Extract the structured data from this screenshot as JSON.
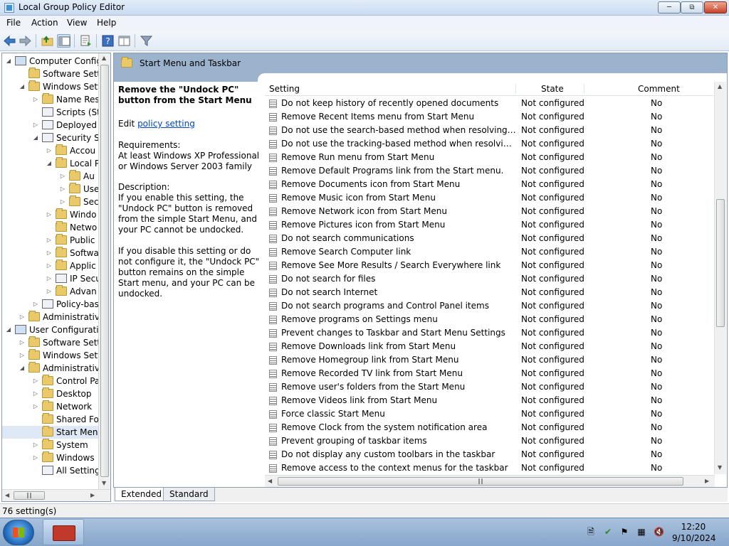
{
  "window": {
    "title": "Local Group Policy Editor",
    "minimize_icon": "minimize-icon",
    "maximize_icon": "maximize-icon",
    "close_icon": "close-icon"
  },
  "menu": [
    "File",
    "Action",
    "View",
    "Help"
  ],
  "toolbar": {
    "icons": [
      "back-arrow-icon",
      "forward-arrow-icon",
      "up-folder-icon",
      "show-hide-tree-icon",
      "export-list-icon",
      "help-icon",
      "properties-icon",
      "filter-icon"
    ]
  },
  "tree": {
    "items": [
      {
        "label": "Computer Config",
        "level": 0,
        "expanded": true,
        "icon": "computer-icon"
      },
      {
        "label": "Software Setti",
        "level": 1,
        "expanded": null,
        "icon": "folder-icon"
      },
      {
        "label": "Windows Sett",
        "level": 1,
        "expanded": true,
        "icon": "folder-icon"
      },
      {
        "label": "Name Res",
        "level": 2,
        "expanded": false,
        "icon": "folder-icon"
      },
      {
        "label": "Scripts (St",
        "level": 2,
        "expanded": null,
        "icon": "scripts-icon"
      },
      {
        "label": "Deployed",
        "level": 2,
        "expanded": false,
        "icon": "printer-icon"
      },
      {
        "label": "Security Se",
        "level": 2,
        "expanded": true,
        "icon": "security-icon"
      },
      {
        "label": "Accou",
        "level": 3,
        "expanded": false,
        "icon": "folder-icon"
      },
      {
        "label": "Local P",
        "level": 3,
        "expanded": true,
        "icon": "folder-icon"
      },
      {
        "label": "Au",
        "level": 4,
        "expanded": false,
        "icon": "folder-icon"
      },
      {
        "label": "Use",
        "level": 4,
        "expanded": false,
        "icon": "folder-icon"
      },
      {
        "label": "Sec",
        "level": 4,
        "expanded": false,
        "icon": "folder-icon"
      },
      {
        "label": "Windo",
        "level": 3,
        "expanded": false,
        "icon": "folder-icon"
      },
      {
        "label": "Netwo",
        "level": 3,
        "expanded": null,
        "icon": "folder-icon"
      },
      {
        "label": "Public",
        "level": 3,
        "expanded": false,
        "icon": "folder-icon"
      },
      {
        "label": "Softwa",
        "level": 3,
        "expanded": false,
        "icon": "folder-icon"
      },
      {
        "label": "Applic",
        "level": 3,
        "expanded": false,
        "icon": "folder-icon"
      },
      {
        "label": "IP Secu",
        "level": 3,
        "expanded": false,
        "icon": "ipsec-icon"
      },
      {
        "label": "Advan",
        "level": 3,
        "expanded": false,
        "icon": "folder-icon"
      },
      {
        "label": "Policy-bas",
        "level": 2,
        "expanded": false,
        "icon": "chart-icon"
      },
      {
        "label": "Administrative",
        "level": 1,
        "expanded": false,
        "icon": "folder-icon"
      },
      {
        "label": "User Configuratio",
        "level": 0,
        "expanded": true,
        "icon": "user-icon"
      },
      {
        "label": "Software Setti",
        "level": 1,
        "expanded": false,
        "icon": "folder-icon"
      },
      {
        "label": "Windows Sett",
        "level": 1,
        "expanded": false,
        "icon": "folder-icon"
      },
      {
        "label": "Administrative",
        "level": 1,
        "expanded": true,
        "icon": "folder-icon"
      },
      {
        "label": "Control Pa",
        "level": 2,
        "expanded": false,
        "icon": "folder-icon"
      },
      {
        "label": "Desktop",
        "level": 2,
        "expanded": false,
        "icon": "folder-icon"
      },
      {
        "label": "Network",
        "level": 2,
        "expanded": false,
        "icon": "folder-icon"
      },
      {
        "label": "Shared Fol",
        "level": 2,
        "expanded": null,
        "icon": "folder-icon"
      },
      {
        "label": "Start Menu",
        "level": 2,
        "expanded": null,
        "icon": "folder-icon",
        "selected": true
      },
      {
        "label": "System",
        "level": 2,
        "expanded": false,
        "icon": "folder-icon"
      },
      {
        "label": "Windows",
        "level": 2,
        "expanded": false,
        "icon": "folder-icon"
      },
      {
        "label": "All Setting",
        "level": 2,
        "expanded": null,
        "icon": "all-settings-icon"
      }
    ]
  },
  "details": {
    "header_title": "Start Menu and Taskbar",
    "description": {
      "title": "Remove the \"Undock PC\" button from the Start Menu",
      "edit_prefix": "Edit ",
      "edit_link": "policy setting",
      "requirements_label": "Requirements:",
      "requirements_text": "At least Windows XP Professional or Windows Server 2003 family",
      "description_label": "Description:",
      "description_p1": "If you enable this setting, the \"Undock PC\" button is removed from the simple Start Menu, and your PC cannot be undocked.",
      "description_p2": "If you disable this setting or do not configure it, the \"Undock PC\" button remains on the simple Start menu, and your PC can be undocked."
    },
    "columns": [
      "Setting",
      "State",
      "Comment"
    ],
    "rows": [
      [
        "Do not keep history of recently opened documents",
        "Not configured",
        "No"
      ],
      [
        "Remove Recent Items menu from Start Menu",
        "Not configured",
        "No"
      ],
      [
        "Do not use the search-based method when resolving shell s...",
        "Not configured",
        "No"
      ],
      [
        "Do not use the tracking-based method when resolving shell ...",
        "Not configured",
        "No"
      ],
      [
        "Remove Run menu from Start Menu",
        "Not configured",
        "No"
      ],
      [
        "Remove Default Programs link from the Start menu.",
        "Not configured",
        "No"
      ],
      [
        "Remove Documents icon from Start Menu",
        "Not configured",
        "No"
      ],
      [
        "Remove Music icon from Start Menu",
        "Not configured",
        "No"
      ],
      [
        "Remove Network icon from Start Menu",
        "Not configured",
        "No"
      ],
      [
        "Remove Pictures icon from Start Menu",
        "Not configured",
        "No"
      ],
      [
        "Do not search communications",
        "Not configured",
        "No"
      ],
      [
        "Remove Search Computer link",
        "Not configured",
        "No"
      ],
      [
        "Remove See More Results / Search Everywhere link",
        "Not configured",
        "No"
      ],
      [
        "Do not search for files",
        "Not configured",
        "No"
      ],
      [
        "Do not search Internet",
        "Not configured",
        "No"
      ],
      [
        "Do not search programs and Control Panel items",
        "Not configured",
        "No"
      ],
      [
        "Remove programs on Settings menu",
        "Not configured",
        "No"
      ],
      [
        "Prevent changes to Taskbar and Start Menu Settings",
        "Not configured",
        "No"
      ],
      [
        "Remove Downloads link from Start Menu",
        "Not configured",
        "No"
      ],
      [
        "Remove Homegroup link from Start Menu",
        "Not configured",
        "No"
      ],
      [
        "Remove Recorded TV link from Start Menu",
        "Not configured",
        "No"
      ],
      [
        "Remove user's folders from the Start Menu",
        "Not configured",
        "No"
      ],
      [
        "Remove Videos link from Start Menu",
        "Not configured",
        "No"
      ],
      [
        "Force classic Start Menu",
        "Not configured",
        "No"
      ],
      [
        "Remove Clock from the system notification area",
        "Not configured",
        "No"
      ],
      [
        "Prevent grouping of taskbar items",
        "Not configured",
        "No"
      ],
      [
        "Do not display any custom toolbars in the taskbar",
        "Not configured",
        "No"
      ],
      [
        "Remove access to the context menus for the taskbar",
        "Not configured",
        "No"
      ]
    ]
  },
  "tabs": [
    "Extended",
    "Standard"
  ],
  "status": "76 setting(s)",
  "taskbar": {
    "clock_time": "12:20",
    "clock_date": "9/10/2024",
    "tray_icons": [
      "notes-icon",
      "security-shield-icon",
      "flag-icon",
      "network-icon",
      "volume-muted-icon"
    ]
  }
}
